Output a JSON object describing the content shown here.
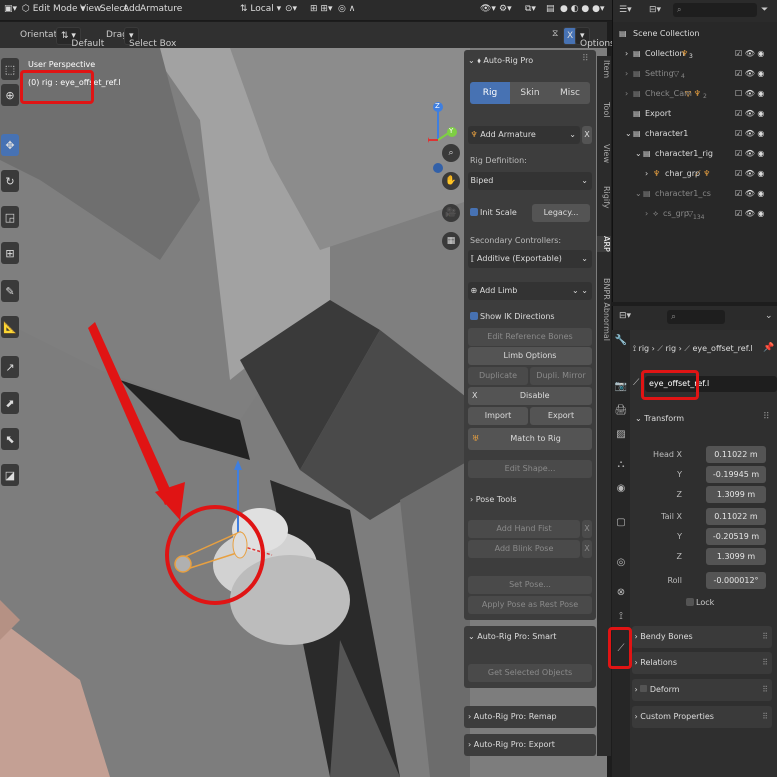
{
  "topbar": {
    "mode": "Edit Mode",
    "menu": [
      "View",
      "Select",
      "Add",
      "Armature"
    ],
    "transform": "Local"
  },
  "header2": {
    "orientation_label": "Orientation:",
    "orientation_value": "Default",
    "drag_label": "Drag:",
    "drag_value": "Select Box",
    "options": "Options"
  },
  "viewport": {
    "title": "User Perspective",
    "subtitle": "(0) rig : eye_offset_ref.l",
    "gizmo": [
      "Y",
      "Z"
    ]
  },
  "npanel": {
    "title": "Auto-Rig Pro",
    "tabs": [
      "Rig",
      "Skin",
      "Misc"
    ],
    "add_armature": "Add Armature",
    "rig_definition_label": "Rig Definition:",
    "rig_definition_value": "Biped",
    "init_scale": "Init Scale",
    "legacy": "Legacy...",
    "secondary_label": "Secondary Controllers:",
    "secondary_value": "Additive (Exportable)",
    "add_limb": "Add Limb",
    "show_ik": "Show IK Directions",
    "edit_ref_bones": "Edit Reference Bones",
    "limb_options": "Limb Options",
    "duplicate": "Duplicate",
    "dupli_mirror": "Dupli. Mirror",
    "x": "X",
    "disable": "Disable",
    "import": "Import",
    "export": "Export",
    "match_to_rig": "Match to Rig",
    "edit_shape": "Edit Shape...",
    "pose_tools": "Pose Tools",
    "add_hand_fist": "Add Hand Fist",
    "add_blink_pose": "Add Blink Pose",
    "set_pose": "Set Pose...",
    "apply_pose": "Apply Pose as Rest Pose",
    "smart_title": "Auto-Rig Pro: Smart",
    "get_selected": "Get Selected Objects",
    "remap_title": "Auto-Rig Pro: Remap",
    "export_title": "Auto-Rig Pro: Export"
  },
  "vtabs": [
    "Item",
    "Tool",
    "View",
    "Rigify",
    "ARP",
    "BNPR Abnormal"
  ],
  "outliner": {
    "items": [
      {
        "label": "Scene Collection",
        "badge": ""
      },
      {
        "label": "Collection",
        "badge": "3"
      },
      {
        "label": "Setting",
        "badge": "4"
      },
      {
        "label": "Check_Cam",
        "badge": "2"
      },
      {
        "label": "Export",
        "badge": ""
      },
      {
        "label": "character1",
        "badge": ""
      },
      {
        "label": "character1_rig",
        "badge": ""
      },
      {
        "label": "char_grp",
        "badge": ""
      },
      {
        "label": "character1_cs",
        "badge": ""
      },
      {
        "label": "cs_grp",
        "badge": "134"
      }
    ]
  },
  "props": {
    "breadcrumb": [
      "rig",
      "rig",
      "eye_offset_ref.l"
    ],
    "bone_name": "eye_offset_ref.l",
    "transform_title": "Transform",
    "head_label": "Head X",
    "head": [
      "0.11022 m",
      "-0.19945 m",
      "1.3099 m"
    ],
    "tail_label": "Tail X",
    "tail": [
      "0.11022 m",
      "-0.20519 m",
      "1.3099 m"
    ],
    "axis_labels": [
      "Y",
      "Z"
    ],
    "roll_label": "Roll",
    "roll": "-0.000012°",
    "lock": "Lock",
    "sections": [
      "Bendy Bones",
      "Relations",
      "Deform",
      "Custom Properties"
    ]
  },
  "colors": {
    "accent": "#4772b3",
    "highlight_red": "#e01414",
    "bone_orange": "#e8a040"
  }
}
